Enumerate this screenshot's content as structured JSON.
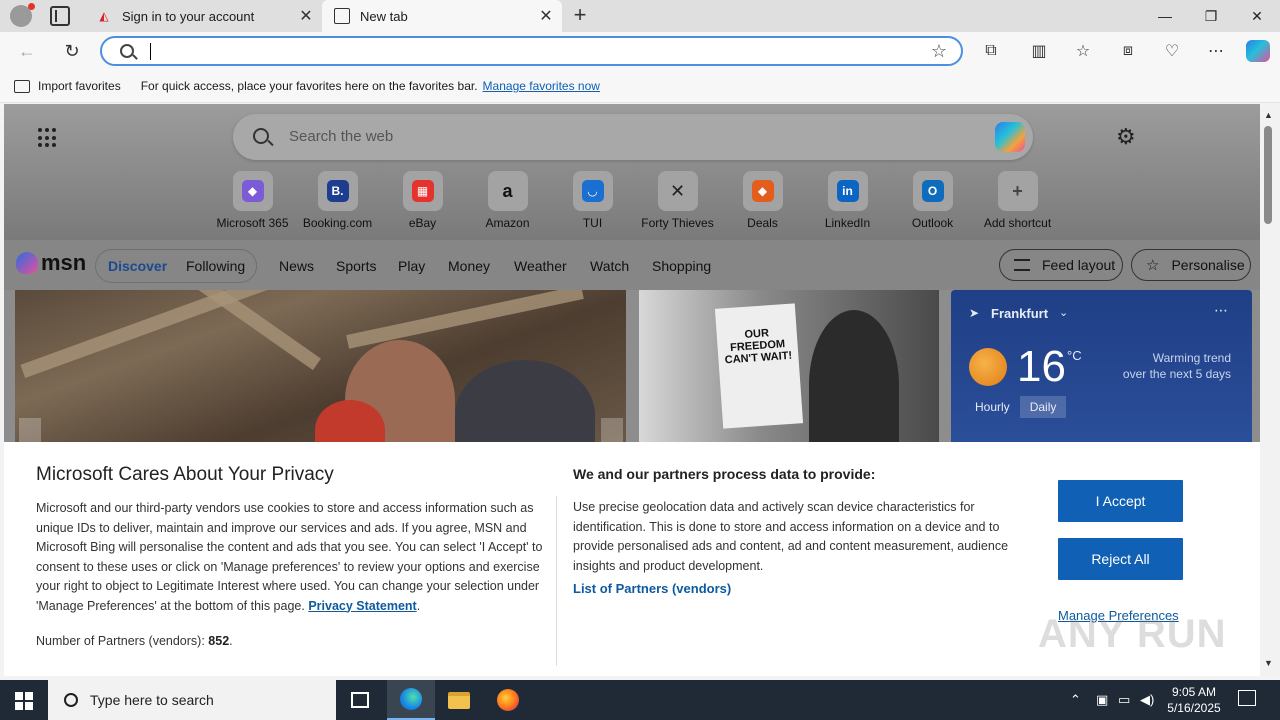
{
  "browser": {
    "tabs": [
      {
        "title": "Sign in to your account",
        "icon": "airtel-logo-icon"
      },
      {
        "title": "New tab",
        "icon": "new-tab-page-icon"
      }
    ],
    "window_controls": {
      "minimize": "—",
      "restore": "❐",
      "close": "✕"
    },
    "address": {
      "value": "",
      "placeholder": ""
    },
    "favorites_bar": {
      "import_label": "Import favorites",
      "hint": "For quick access, place your favorites here on the favorites bar.",
      "manage_link": "Manage favorites now"
    }
  },
  "newtab": {
    "search_placeholder": "Search the web",
    "shortcuts": [
      {
        "label": "Microsoft 365",
        "glyph": "◆",
        "color": "#7b5bd6"
      },
      {
        "label": "Booking.com",
        "glyph": "B.",
        "color": "#1d3d8f"
      },
      {
        "label": "eBay",
        "glyph": "▦",
        "color": "#e5322d"
      },
      {
        "label": "Amazon",
        "glyph": "a",
        "color": "#111111"
      },
      {
        "label": "TUI",
        "glyph": "◡",
        "color": "#1a6fd1"
      },
      {
        "label": "Forty Thieves",
        "glyph": "✕",
        "color": "#222222"
      },
      {
        "label": "Deals",
        "glyph": "◆",
        "color": "#e35d1d"
      },
      {
        "label": "LinkedIn",
        "glyph": "in",
        "color": "#0a66c2"
      },
      {
        "label": "Outlook",
        "glyph": "O",
        "color": "#0f6cbd"
      },
      {
        "label": "Add shortcut",
        "glyph": "+",
        "color": "#444444"
      }
    ],
    "msn": {
      "logo": "msn",
      "nav_pill": [
        "Discover",
        "Following"
      ],
      "nav": [
        "News",
        "Sports",
        "Play",
        "Money",
        "Weather",
        "Watch",
        "Shopping"
      ],
      "feed_layout": "Feed layout",
      "personalise": "Personalise"
    },
    "weather": {
      "location": "Frankfurt",
      "temperature": "16",
      "unit": "°C",
      "trend_line1": "Warming trend",
      "trend_line2": "over the next 5 days",
      "tabs": [
        "Hourly",
        "Daily"
      ]
    },
    "hero_poster": "OUR FREEDOM CAN'T WAIT!"
  },
  "consent": {
    "title": "Microsoft Cares About Your Privacy",
    "body": "Microsoft and our third-party vendors use cookies to store and access information such as unique IDs to deliver, maintain and improve our services and ads. If you agree, MSN and Microsoft Bing will personalise the content and ads that you see. You can select 'I Accept' to consent to these uses or click on 'Manage preferences' to review your options and exercise your right to object to Legitimate Interest where used.  You can change your selection under 'Manage Preferences' at the bottom of this page.",
    "privacy_link": "Privacy Statement",
    "partners_count_label": "Number of Partners (vendors):",
    "partners_count": "852",
    "right_title": "We and our partners process data to provide:",
    "right_body": "Use precise geolocation data and actively scan device characteristics for identification. This is done to store and access information on a device and to provide personalised ads and content, ad and content measurement, audience insights and product development.",
    "partners_link": "List of Partners (vendors)",
    "accept": "I Accept",
    "reject": "Reject All",
    "manage": "Manage Preferences"
  },
  "watermark": "ANY RUN",
  "taskbar": {
    "search_placeholder": "Type here to search",
    "time": "9:05 AM",
    "date": "5/16/2025"
  }
}
